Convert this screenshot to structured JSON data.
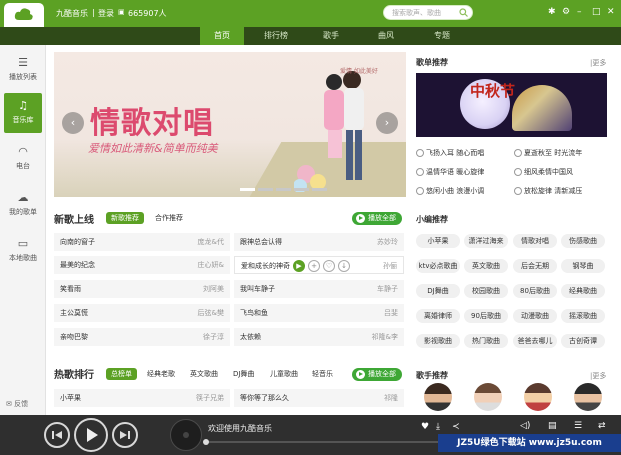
{
  "app": {
    "name": "九酷音乐",
    "login": "登录",
    "separator": "|",
    "online_count": "665907人"
  },
  "search": {
    "placeholder": "搜索歌声、歌曲"
  },
  "nav": {
    "tabs": [
      "首页",
      "排行榜",
      "歌手",
      "曲风",
      "专题"
    ],
    "active": "首页"
  },
  "sidebar": {
    "items": [
      {
        "label": "播放列表",
        "icon": "list-icon"
      },
      {
        "label": "音乐库",
        "icon": "music-note-icon",
        "active": true
      },
      {
        "label": "电台",
        "icon": "wifi-icon"
      },
      {
        "label": "我的歌单",
        "icon": "cloud-icon"
      },
      {
        "label": "本地歌曲",
        "icon": "monitor-icon"
      }
    ],
    "feedback": "反馈"
  },
  "banner": {
    "title": "情歌对唱",
    "subtitle": "爱情如此清新&简单而纯美",
    "tag": "爱情 如此美好"
  },
  "new_songs": {
    "title": "新歌上线",
    "tabs": [
      "新歌推荐",
      "合作推荐"
    ],
    "play_all": "播放全部",
    "rows": [
      {
        "name": "向南的窗子",
        "artist": "庞龙&代"
      },
      {
        "name": "跟神总会认得",
        "artist": "苏妙玲"
      },
      {
        "name": "最美的纪念",
        "artist": "庄心妍&"
      },
      {
        "name": "爱和成长的神奇",
        "artist": "孙俪"
      },
      {
        "name": "笑看雨",
        "artist": "刘阿美"
      },
      {
        "name": "我叫车静子",
        "artist": "车静子"
      },
      {
        "name": "主公莫慌",
        "artist": "后弦&樊"
      },
      {
        "name": "飞鸟和鱼",
        "artist": "吕斐"
      },
      {
        "name": "亲吻巴黎",
        "artist": "徐子淳"
      },
      {
        "name": "太依赖",
        "artist": "祁隆&李"
      }
    ]
  },
  "hot_songs": {
    "title": "热歌排行",
    "tabs": [
      "总榜单",
      "经典老歌",
      "英文歌曲",
      "DJ舞曲",
      "儿童歌曲",
      "轻音乐"
    ],
    "play_all": "播放全部",
    "rows": [
      {
        "name": "小苹果",
        "artist": "筷子兄弟"
      },
      {
        "name": "等你等了那么久",
        "artist": "祁隆"
      }
    ]
  },
  "playlists": {
    "title": "歌单推荐",
    "more": "|更多",
    "image_text": "中秋节",
    "items": [
      "飞扬入耳 随心而唱",
      "夏逝秋至 时光流年",
      "温情华语 暖心旋律",
      "细风柔情中国风",
      "悠闲小曲 浪漫小调",
      "放松旋律 清新减压"
    ]
  },
  "editor": {
    "title": "小编推荐",
    "tags": [
      "小苹果",
      "潇洋过海来",
      "情歌对唱",
      "伤感歌曲",
      "ktv必点歌曲",
      "英文歌曲",
      "后会无期",
      "钢琴曲",
      "DJ舞曲",
      "校园歌曲",
      "80后歌曲",
      "经典歌曲",
      "离婚律师",
      "90后歌曲",
      "动漫歌曲",
      "摇滚歌曲",
      "影视歌曲",
      "热门歌曲",
      "爸爸去哪儿",
      "古创奇谭"
    ]
  },
  "singers": {
    "title": "歌手推荐",
    "more": "|更多"
  },
  "player": {
    "now_playing": "欢迎使用九酷音乐"
  },
  "watermark": "JZ5U绿色下载站 www.jz5u.com",
  "colors": {
    "brand_green": "#5ca124",
    "nav_dark": "#2f4a18",
    "player_bg": "#2f2f2f",
    "play_all": "#3ea735"
  }
}
